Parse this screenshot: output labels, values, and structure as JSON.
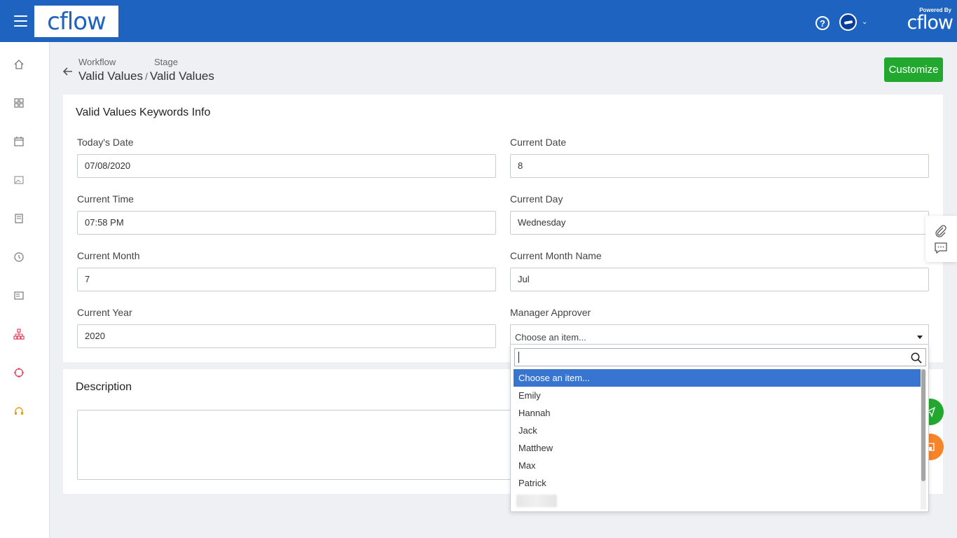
{
  "app": {
    "logo": "cflow",
    "powered_by_label": "Powered By",
    "powered_by_logo": "cflow"
  },
  "breadcrumb": {
    "workflow_label": "Workflow",
    "stage_label": "Stage",
    "workflow_name": "Valid Values",
    "separator": "/",
    "stage_name": "Valid Values"
  },
  "toolbar": {
    "customize_label": "Customize"
  },
  "form": {
    "title": "Valid Values Keywords Info",
    "fields": {
      "todays_date": {
        "label": "Today's Date",
        "value": "07/08/2020"
      },
      "current_date": {
        "label": "Current Date",
        "value": "8"
      },
      "current_time": {
        "label": "Current Time",
        "value": "07:58 PM"
      },
      "current_day": {
        "label": "Current Day",
        "value": "Wednesday"
      },
      "current_month": {
        "label": "Current Month",
        "value": "7"
      },
      "current_month_name": {
        "label": "Current Month Name",
        "value": "Jul"
      },
      "current_year": {
        "label": "Current Year",
        "value": "2020"
      },
      "manager_approver": {
        "label": "Manager Approver",
        "value": "Choose an item..."
      }
    }
  },
  "dropdown": {
    "search_value": "",
    "options": [
      "Choose an item...",
      "Emily",
      "Hannah",
      "Jack",
      "Matthew",
      "Max",
      "Patrick"
    ],
    "selected_index": 0
  },
  "description": {
    "title": "Description",
    "value": ""
  },
  "colors": {
    "brand": "#1e63c0",
    "accent_green": "#22a82f",
    "highlight": "#3875d0",
    "fab_orange": "#f5842a"
  },
  "icons": {
    "sidebar": [
      "home-icon",
      "grid-icon",
      "calendar-icon",
      "image-card-icon",
      "book-icon",
      "history-icon",
      "report-icon",
      "org-chart-icon",
      "target-icon",
      "headset-icon"
    ],
    "floating": [
      "paperclip-icon",
      "comment-icon"
    ]
  }
}
